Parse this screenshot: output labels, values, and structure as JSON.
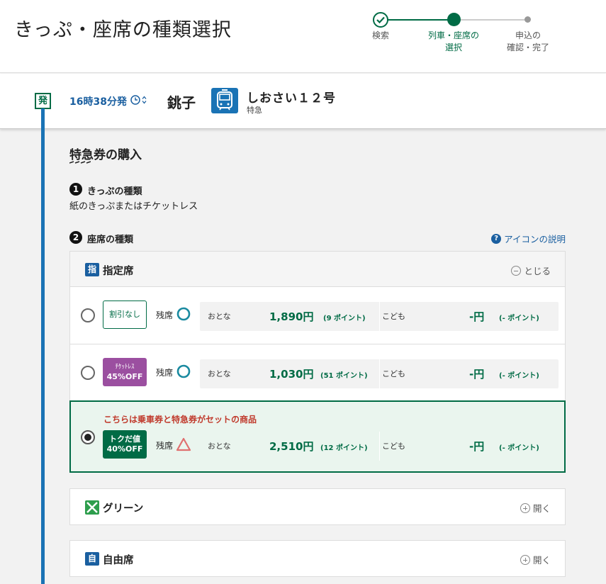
{
  "header": {
    "title": "きっぷ・座席の種類選択",
    "steps": [
      {
        "label": "検索",
        "state": "done"
      },
      {
        "label": "列車・座席の\n選択",
        "state": "current"
      },
      {
        "label": "申込の\n確認・完了",
        "state": "todo"
      }
    ]
  },
  "train": {
    "dep_badge": "発",
    "dep_time": "16時38分発",
    "station": "銚子",
    "name": "しおさい１２号",
    "type": "特急"
  },
  "purchase": {
    "title": "特急券の購入",
    "q1_num": "1",
    "q1_label": "きっぷの種類",
    "q1_value": "紙のきっぷまたはチケットレス",
    "q2_num": "2",
    "q2_label": "座席の種類",
    "help_label": "アイコンの説明",
    "help_glyph": "?"
  },
  "reserved": {
    "icon": "指",
    "name": "指定席",
    "toggle": "とじる",
    "options": [
      {
        "badge_line1": "割引なし",
        "badge_line2": "",
        "avail_label": "残席",
        "adult_label": "おとな",
        "adult_price": "1,890円",
        "adult_points": "(9 ポイント)",
        "child_label": "こども",
        "child_price": "-円",
        "child_points": "(- ポイント)"
      },
      {
        "badge_line1": "ﾁｹｯﾄﾚｽ",
        "badge_line2": "45%OFF",
        "avail_label": "残席",
        "adult_label": "おとな",
        "adult_price": "1,030円",
        "adult_points": "(51 ポイント)",
        "child_label": "こども",
        "child_price": "-円",
        "child_points": "(- ポイント)"
      },
      {
        "note": "こちらは乗車券と特急券がセットの商品",
        "badge_line1": "トクだ値",
        "badge_line2": "40%OFF",
        "avail_label": "残席",
        "adult_label": "おとな",
        "adult_price": "2,510円",
        "adult_points": "(12 ポイント)",
        "child_label": "こども",
        "child_price": "-円",
        "child_points": "(- ポイント)"
      }
    ]
  },
  "green": {
    "name": "グリーン",
    "toggle": "開く"
  },
  "nonreserved": {
    "icon": "自",
    "name": "自由席",
    "toggle": "開く"
  },
  "colors": {
    "accent_green": "#006b45",
    "link_blue": "#1a5fa0",
    "timeline_blue": "#1a73b5",
    "discount_purple": "#9b4fa0",
    "alert_red": "#c0392b",
    "few_seats_triangle": "#e07070",
    "avail_circle": "#1a8aa0"
  },
  "icons": {
    "step_done": "check-icon",
    "time_selector": "clock-updown-icon",
    "train": "train-icon",
    "help": "question-circle-icon",
    "available": "circle-available-icon",
    "few_left": "triangle-few-icon",
    "collapse": "minus-circle-icon",
    "expand": "plus-circle-icon"
  }
}
